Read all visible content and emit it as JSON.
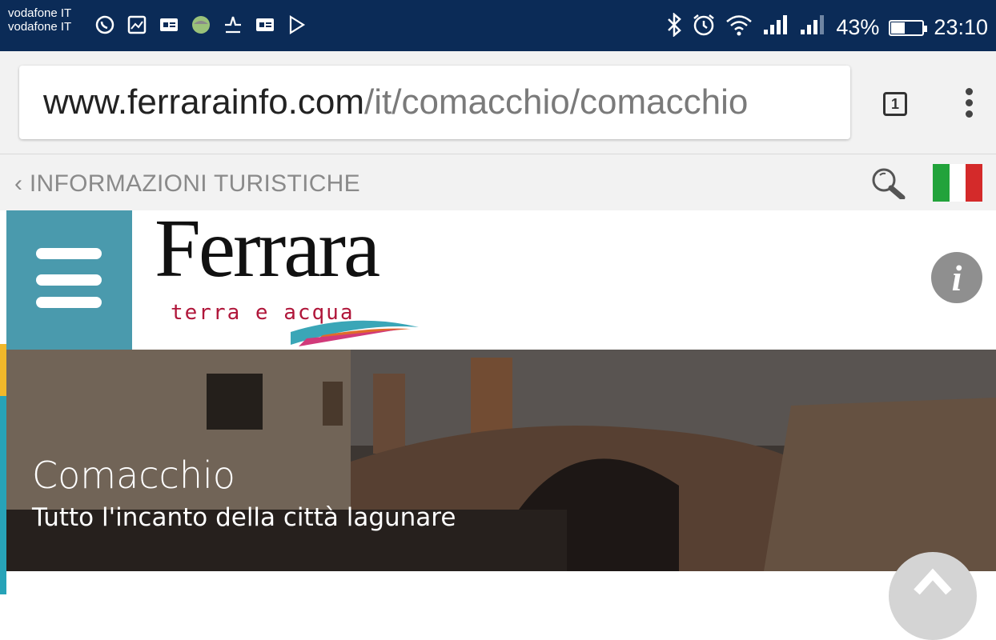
{
  "status_bar": {
    "carrier_1": "vodafone IT",
    "carrier_2": "vodafone IT",
    "notification_icons": [
      "whatsapp-icon",
      "gallery-icon",
      "message-icon",
      "app-icon",
      "pdf-icon",
      "message-icon",
      "play-store-icon"
    ],
    "system_icons": [
      "bluetooth-icon",
      "alarm-icon",
      "wifi-icon",
      "signal-icon",
      "signal-icon"
    ],
    "battery_percent_label": "43%",
    "battery_level": 0.43,
    "time": "23:10"
  },
  "browser": {
    "url_host": "www.ferrarainfo.com",
    "url_path": "/it/comacchio/comacchio",
    "tab_count": "1"
  },
  "site": {
    "back_link": "‹ INFORMAZIONI TURISTICHE",
    "logo": {
      "title": "Ferrara",
      "tagline": "terra e acqua"
    },
    "language_flag": "italy-flag-icon",
    "info_label": "i",
    "colors": {
      "menu_bg": "#4a9aad",
      "accent_teal": "#27a3b8",
      "accent_yellow": "#f1b82a",
      "statusbar_bg": "#0b2b57"
    }
  },
  "hero": {
    "title": "Comacchio",
    "subtitle": "Tutto l'incanto della città lagunare"
  }
}
